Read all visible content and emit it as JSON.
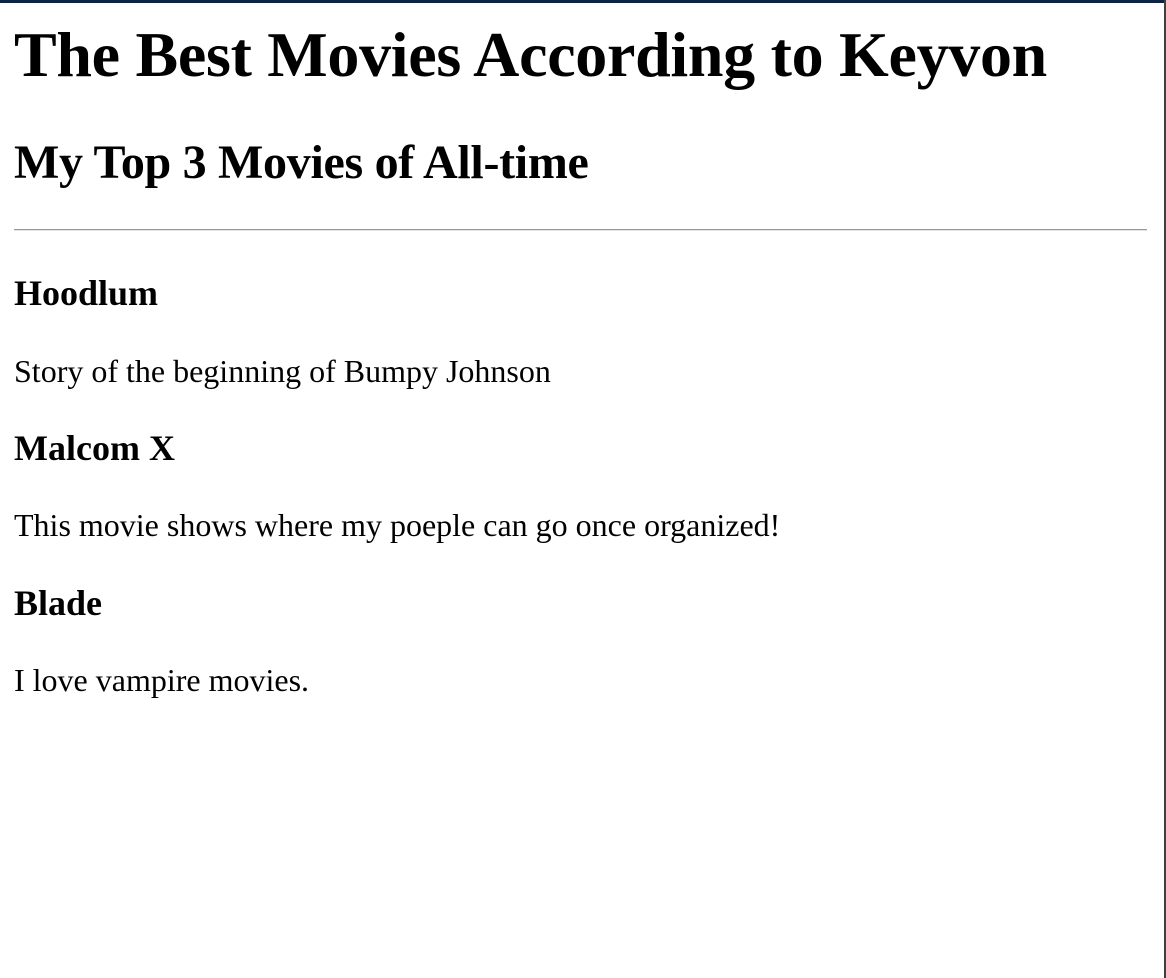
{
  "page": {
    "title": "The Best Movies According to Keyvon",
    "subtitle": "My Top 3 Movies of All-time"
  },
  "movies": [
    {
      "title": "Hoodlum",
      "description": "Story of the beginning of Bumpy Johnson"
    },
    {
      "title": "Malcom X",
      "description": "This movie shows where my poeple can go once organized!"
    },
    {
      "title": "Blade",
      "description": "I love vampire movies."
    }
  ]
}
